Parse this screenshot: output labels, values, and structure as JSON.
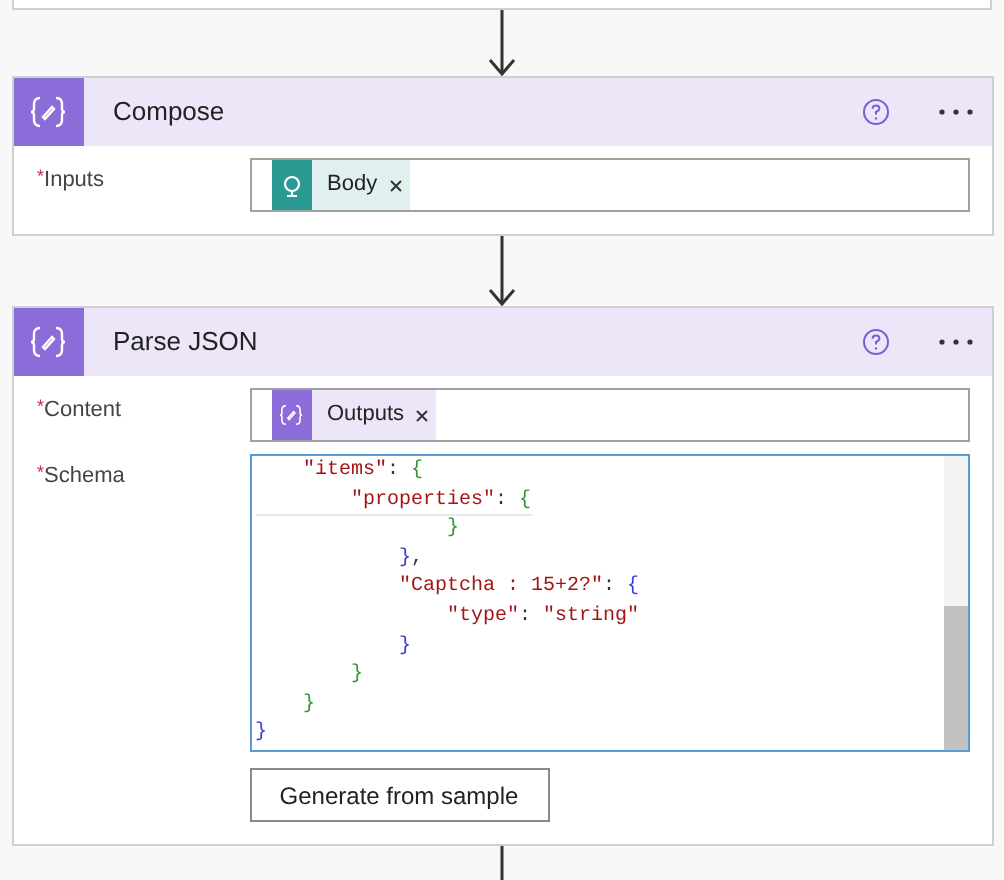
{
  "cards": [
    {
      "title": "Compose",
      "fields": [
        {
          "required_mark": "*",
          "label": "Inputs",
          "kind": "tokens",
          "tokens": [
            {
              "label": "Body",
              "kind": "request"
            }
          ]
        }
      ]
    },
    {
      "title": "Parse JSON",
      "fields": [
        {
          "required_mark": "*",
          "label": "Content",
          "kind": "tokens",
          "tokens": [
            {
              "label": "Outputs",
              "kind": "compose"
            }
          ]
        },
        {
          "required_mark": "*",
          "label": "Schema",
          "kind": "code",
          "lines": [
            [
              {
                "kind": "key",
                "text": "    \"items\""
              },
              {
                "kind": "punct",
                "text": ": "
              },
              {
                "kind": "brace_green",
                "text": "{"
              }
            ],
            [
              {
                "kind": "key",
                "text": "        \"properties\""
              },
              {
                "kind": "punct",
                "text": ": "
              },
              {
                "kind": "brace_green",
                "text": "{"
              }
            ],
            [
              {
                "kind": "brace_green",
                "text": "                }"
              }
            ],
            [
              {
                "kind": "brace_blue",
                "text": "            }"
              },
              {
                "kind": "punct",
                "text": ","
              }
            ],
            [
              {
                "kind": "key",
                "text": "            \"Captcha : 15+2?\""
              },
              {
                "kind": "punct",
                "text": ": "
              },
              {
                "kind": "brace_blue",
                "text": "{"
              }
            ],
            [
              {
                "kind": "key",
                "text": "                \"type\""
              },
              {
                "kind": "punct",
                "text": ": "
              },
              {
                "kind": "string",
                "text": "\"string\""
              }
            ],
            [
              {
                "kind": "brace_blue",
                "text": "            }"
              }
            ],
            [
              {
                "kind": "brace_green",
                "text": "        }"
              }
            ],
            [
              {
                "kind": "brace_green",
                "text": "    }"
              }
            ],
            [
              {
                "kind": "brace_blue",
                "text": "}"
              }
            ]
          ]
        }
      ],
      "button": "Generate from sample"
    }
  ]
}
